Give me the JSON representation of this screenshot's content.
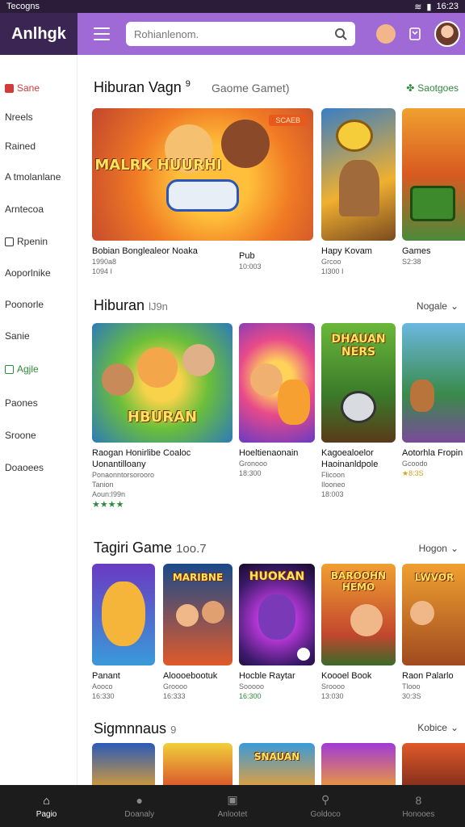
{
  "status": {
    "left": "Tecogns",
    "right": "16:23"
  },
  "header": {
    "brand": "Anlhgk",
    "search_placeholder": "Rohianlenom."
  },
  "sidebar": {
    "items": [
      {
        "label": "Sane"
      },
      {
        "label": "Nreels"
      },
      {
        "label": "Rained"
      },
      {
        "label": "A tmolanlane"
      },
      {
        "label": "Arntecoa"
      },
      {
        "label": "Rpenin"
      },
      {
        "label": "Aoporlnike"
      },
      {
        "label": "Poonorle"
      },
      {
        "label": "Sanie"
      },
      {
        "label": "Agjle"
      },
      {
        "label": "Paones"
      },
      {
        "label": "Sroone"
      },
      {
        "label": "Doaoees"
      }
    ]
  },
  "sections": [
    {
      "title": "Hiburan Vagn",
      "mark": "9",
      "subtitle": "Gaome Gamet)",
      "action": "Saotgoes",
      "cards": [
        {
          "art": "MALRK HUURHI",
          "badge": "SCAEB",
          "title": "Bobian Bonglealeor Noaka",
          "meta1": "1990a8",
          "meta2": "1094 I"
        },
        {
          "art": "",
          "title": "Pub",
          "meta1": "10:003",
          "meta2": ""
        },
        {
          "art": "",
          "title": "Hapy Kovam",
          "meta1": "Grcoo",
          "meta2": "1I300 I"
        },
        {
          "art": "",
          "title": "Games",
          "meta1": "S2:38",
          "meta2": ""
        }
      ]
    },
    {
      "title": "Hiburan",
      "mark": "lJ9n",
      "subtitle": "",
      "action": "Nogale",
      "cards": [
        {
          "art": "HBURAN",
          "title": "Raogan Honirlibe Coaloc Uonantilloany",
          "meta1": "Ponaonntorsorooro",
          "meta2": "Tanion",
          "meta3": "Aoun:I99n",
          "stars": "★★★★"
        },
        {
          "art": "",
          "title": "Hoeltienaonain",
          "meta1": "Gronooo",
          "meta2": "18:300"
        },
        {
          "art": "DHAUAN NERS",
          "title": "Kagoealoelor Haoinanldpole",
          "meta1": "Flicoon",
          "meta2": "Ilooneo",
          "meta3": "18:003"
        },
        {
          "art": "",
          "title": "Aotorhla Fropin",
          "meta1": "Gcoodo",
          "meta2": "★8:3S"
        }
      ]
    },
    {
      "title": "Tagiri Game",
      "mark": "1oo.7",
      "subtitle": "",
      "action": "Hogon",
      "cards": [
        {
          "art": "",
          "title": "Panant",
          "meta1": "Aooco",
          "meta2": "16:330"
        },
        {
          "art": "MARIBNE",
          "title": "Aloooebootuk",
          "meta1": "Groooo",
          "meta2": "16:333"
        },
        {
          "art": "HUOKAN",
          "title": "Hocble Raytar",
          "meta1": "Sooooo",
          "meta2": "16:300"
        },
        {
          "art": "BAROOHN HEMO",
          "title": "Koooel Book",
          "meta1": "Sroooo",
          "meta2": "13:030"
        },
        {
          "art": "LWVOR",
          "title": "Raon Palarlo",
          "meta1": "Tlooo",
          "meta2": "30:3S"
        }
      ]
    },
    {
      "title": "Sigmnnaus",
      "mark": "9",
      "subtitle": "",
      "action": "Kobice",
      "cards": [
        {
          "art": ""
        },
        {
          "art": ""
        },
        {
          "art": "SNAUAN"
        },
        {
          "art": ""
        },
        {
          "art": ""
        }
      ]
    }
  ],
  "bottom_nav": [
    {
      "label": "Pagio",
      "icon": "home-icon"
    },
    {
      "label": "Doanaly",
      "icon": "people-icon"
    },
    {
      "label": "Anlootet",
      "icon": "bookmark-icon"
    },
    {
      "label": "Goldoco",
      "icon": "search-icon"
    },
    {
      "label": "Honooes",
      "icon": "profile-icon"
    }
  ]
}
